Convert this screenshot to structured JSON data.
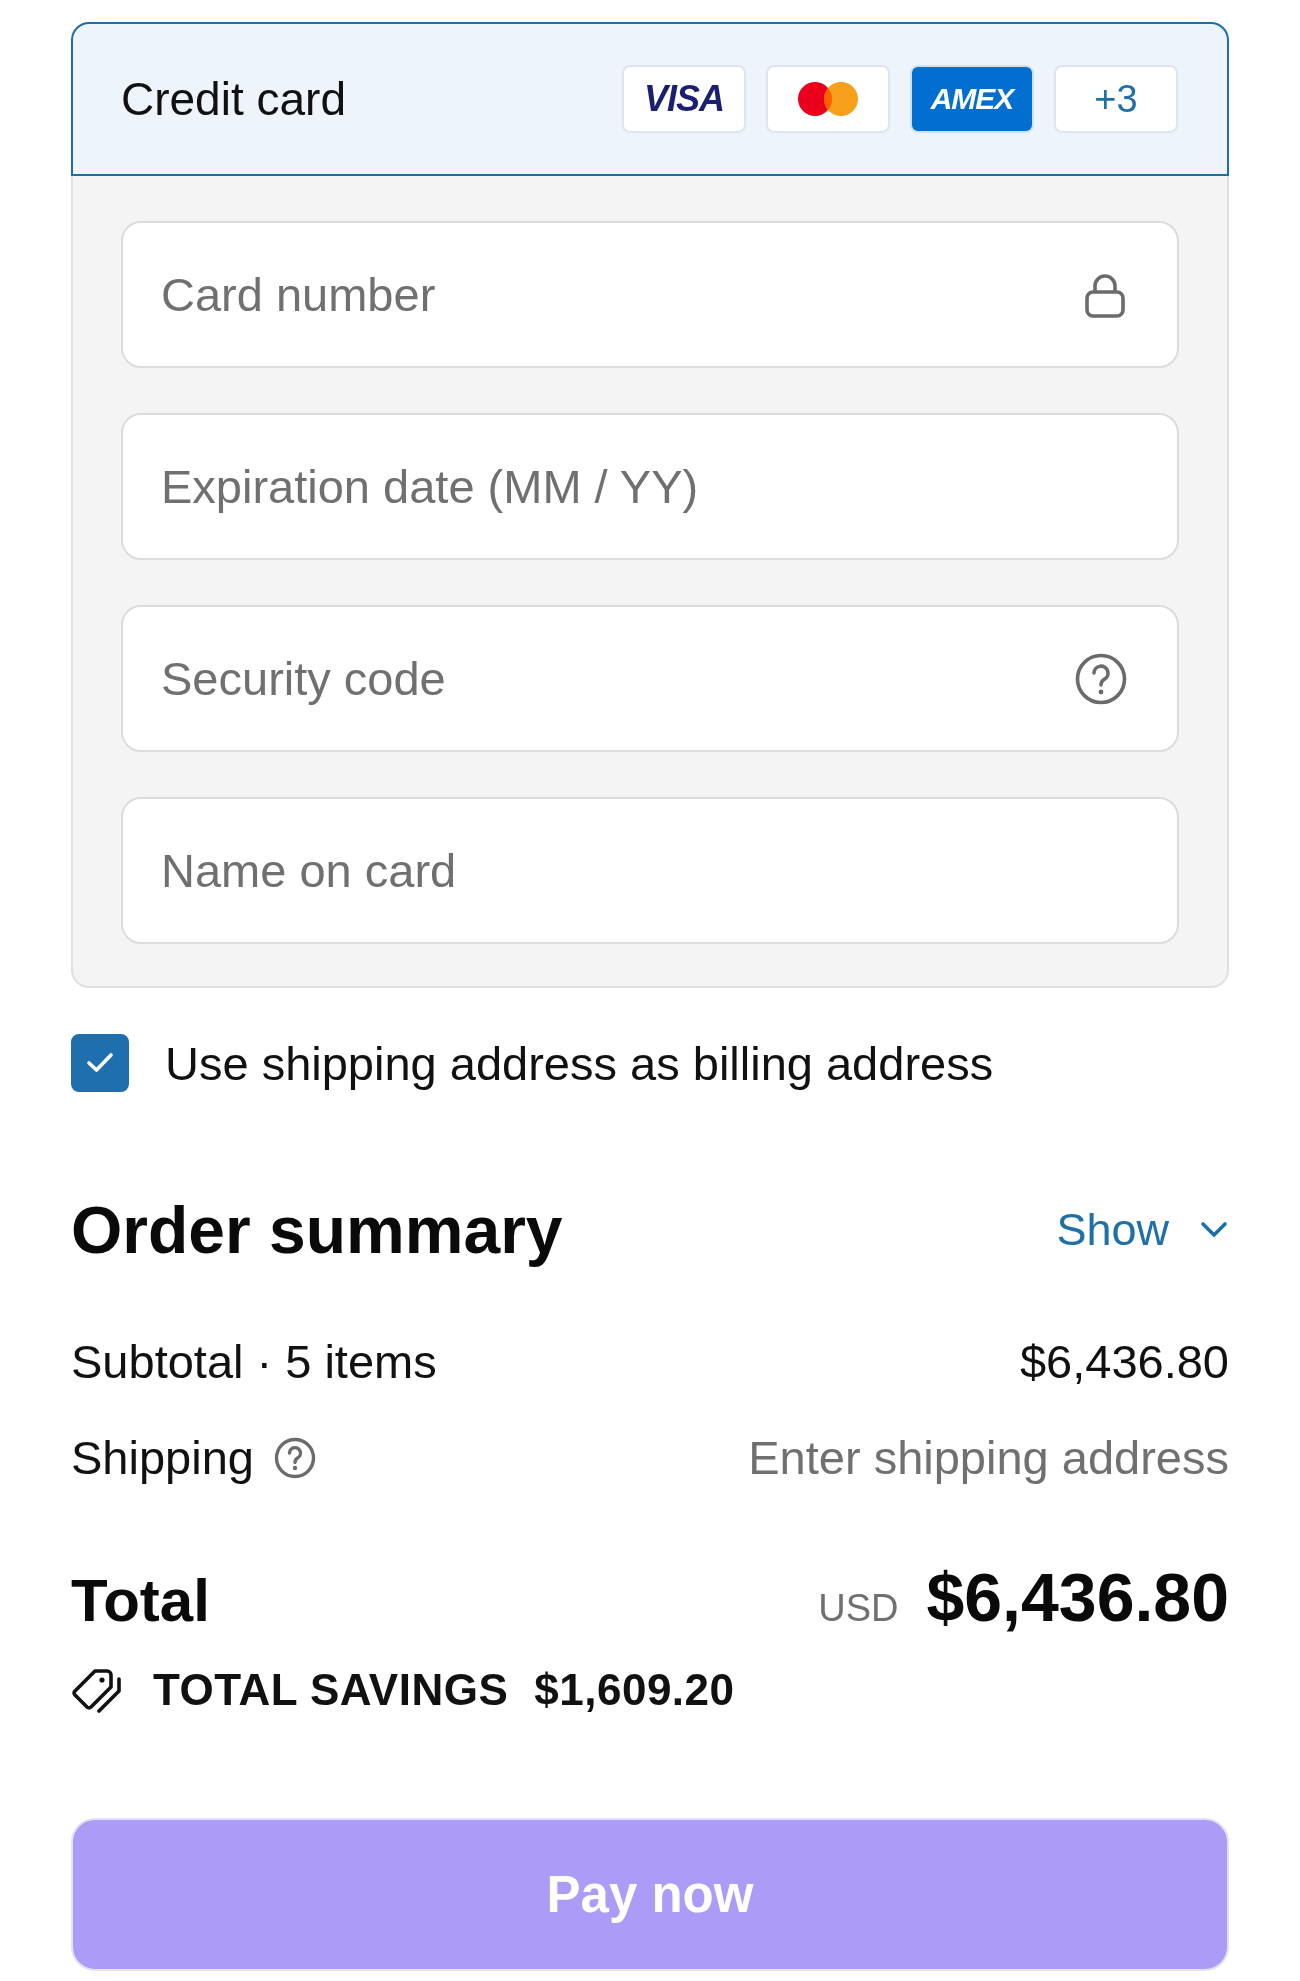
{
  "payment_method": {
    "title": "Credit card",
    "selected": true,
    "card_brands": [
      {
        "kind": "visa",
        "label": "VISA"
      },
      {
        "kind": "mastercard"
      },
      {
        "kind": "amex",
        "label": "AMEX"
      },
      {
        "kind": "more",
        "label": "+3"
      }
    ]
  },
  "fields": [
    {
      "kind": "lock",
      "placeholder": "Card number"
    },
    {
      "kind": "plain",
      "placeholder": "Expiration date (MM / YY)"
    },
    {
      "kind": "help",
      "placeholder": "Security code"
    },
    {
      "kind": "plain",
      "placeholder": "Name on card"
    }
  ],
  "billing_checkbox": {
    "label": "Use shipping address as billing address",
    "checked": true
  },
  "order_summary": {
    "title": "Order summary",
    "toggle": {
      "label": "Show",
      "expanded": false
    },
    "lines": [
      {
        "kind": "amount",
        "label": "Subtotal · 5 items",
        "help": false,
        "value": "$6,436.80"
      },
      {
        "kind": "pending",
        "label": "Shipping",
        "help": true,
        "value": "Enter shipping address"
      }
    ],
    "total": {
      "label": "Total",
      "currency": "USD",
      "value": "$6,436.80"
    },
    "savings": {
      "label": "TOTAL SAVINGS",
      "value": "$1,609.20"
    }
  },
  "pay_button": {
    "label": "Pay now",
    "disabled": true
  }
}
